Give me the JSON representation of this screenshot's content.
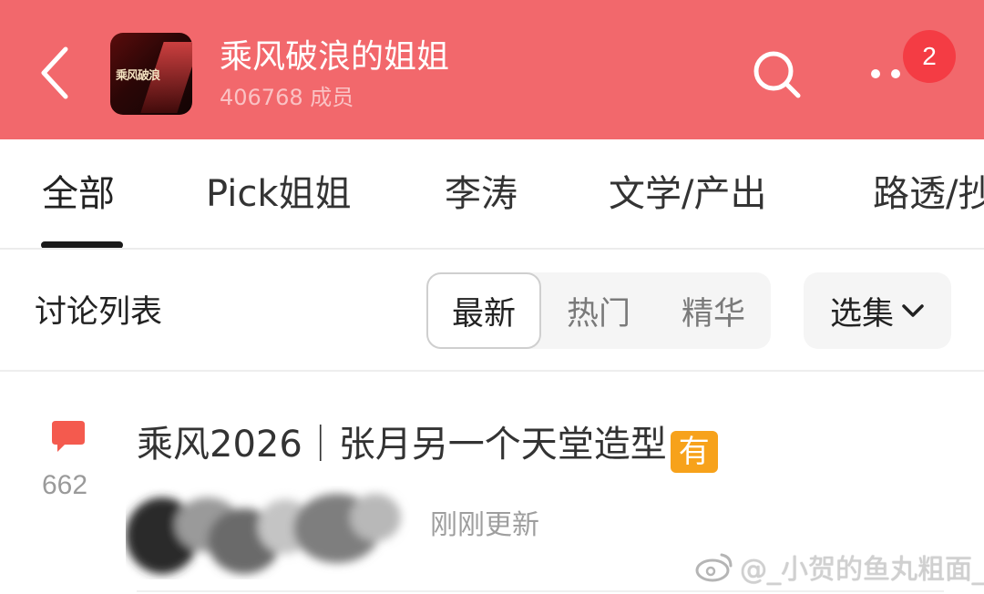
{
  "header": {
    "title": "乘风破浪的姐姐",
    "members": "406768 成员",
    "avatar_text": "乘风破浪",
    "notification_count": "2",
    "bg_color": "#f2686c",
    "icons": {
      "back": "back-chevron-icon",
      "search": "search-icon",
      "more": "more-dots-icon"
    }
  },
  "tabs": [
    {
      "label": "全部",
      "active": true
    },
    {
      "label": "Pick姐姐",
      "active": false
    },
    {
      "label": "李涛",
      "active": false
    },
    {
      "label": "文学/产出",
      "active": false
    },
    {
      "label": "路透/抄",
      "active": false
    }
  ],
  "list_bar": {
    "title": "讨论列表",
    "sort_options": [
      {
        "label": "最新",
        "active": true
      },
      {
        "label": "热门",
        "active": false
      },
      {
        "label": "精华",
        "active": false
      }
    ],
    "episode_label": "选集"
  },
  "post": {
    "comment_count": "662",
    "title": "乘风2026｜张月另一个天堂造型",
    "title_badge": "有",
    "updated": "刚刚更新",
    "watermark": "@_小贺的鱼丸粗面_"
  }
}
